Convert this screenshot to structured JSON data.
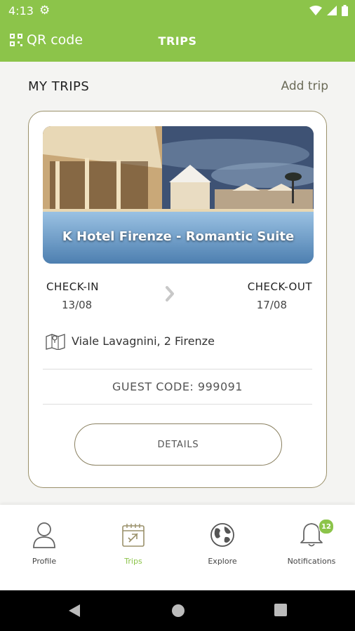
{
  "statusbar": {
    "time": "4:13"
  },
  "appbar": {
    "qr_label": "QR code",
    "title": "TRIPS"
  },
  "section": {
    "title": "MY TRIPS",
    "add_label": "Add trip"
  },
  "trip": {
    "hotel_name": "K Hotel Firenze - Romantic Suite",
    "checkin_label": "CHECK-IN",
    "checkin_date": "13/08",
    "checkout_label": "CHECK-OUT",
    "checkout_date": "17/08",
    "address": "Viale Lavagnini, 2 Firenze",
    "guest_code": "GUEST CODE: 999091",
    "details_label": "DETAILS"
  },
  "nav": {
    "items": [
      {
        "label": "Profile",
        "icon": "person-icon"
      },
      {
        "label": "Trips",
        "icon": "calendar-plane-icon"
      },
      {
        "label": "Explore",
        "icon": "globe-icon"
      },
      {
        "label": "Notifications",
        "icon": "bell-icon",
        "badge": "12"
      }
    ]
  },
  "colors": {
    "accent": "#8cc44a",
    "border": "#9a906a"
  }
}
